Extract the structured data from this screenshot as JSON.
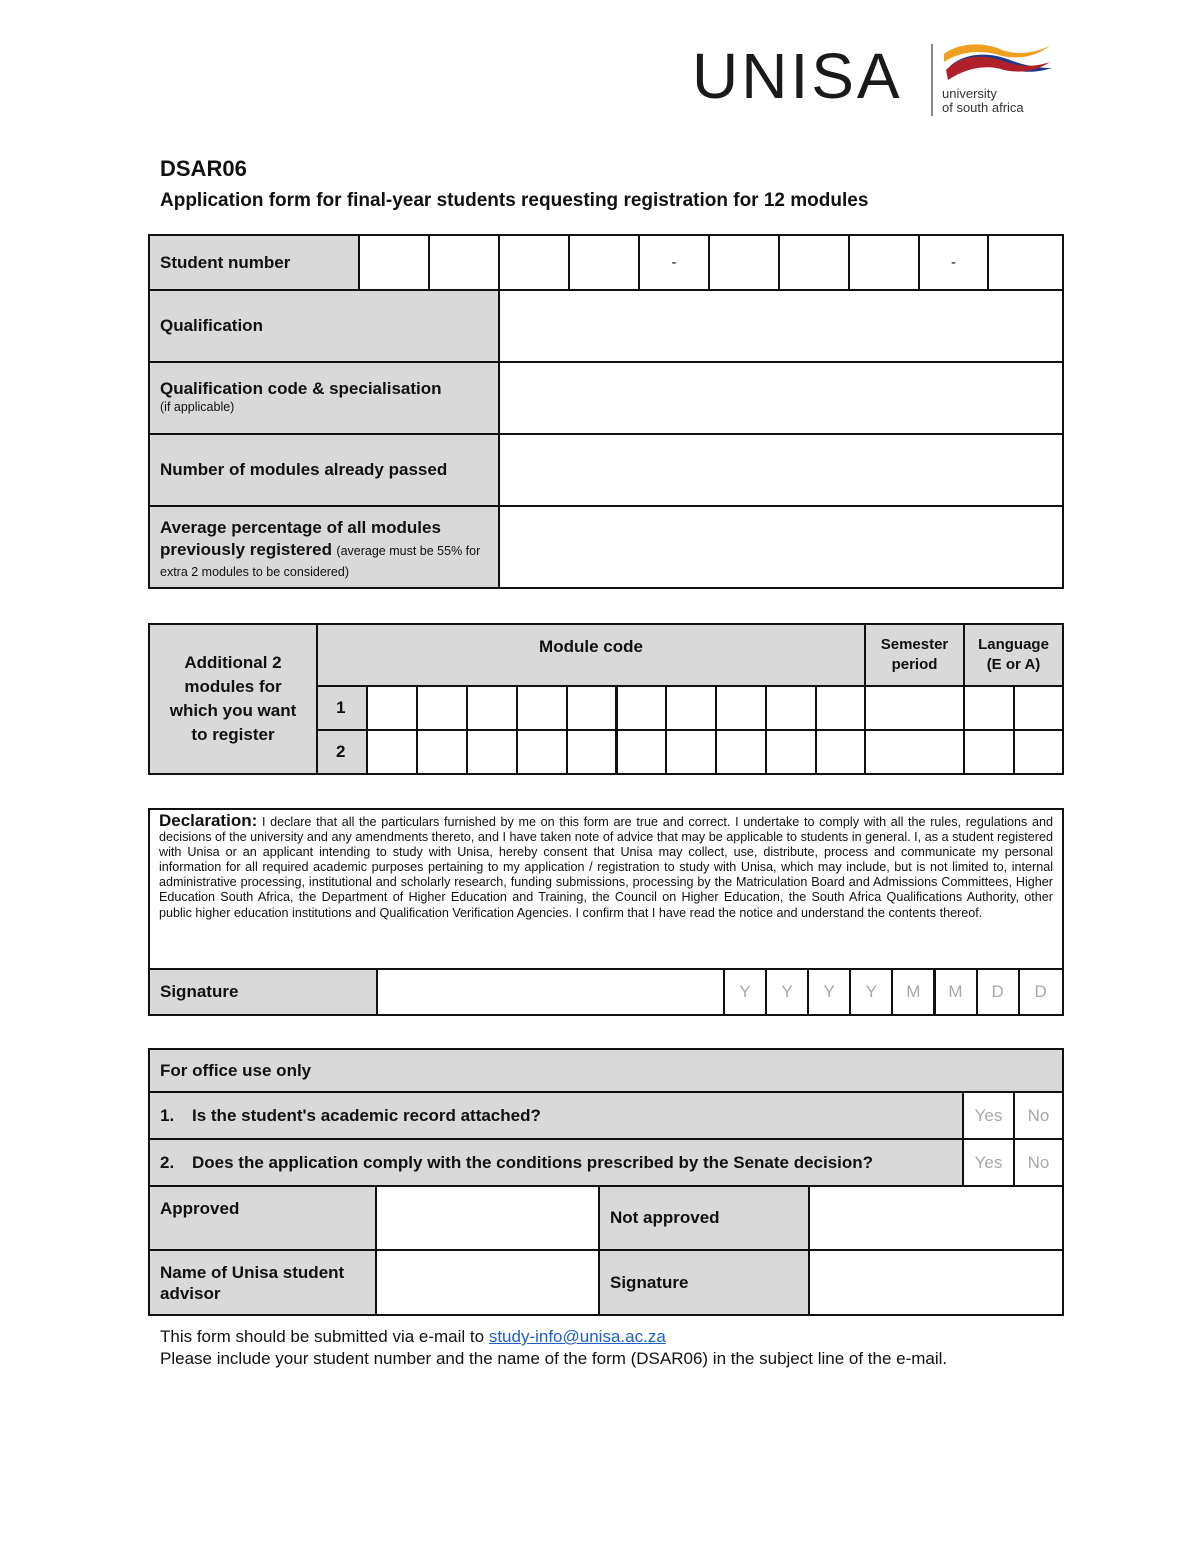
{
  "header": {
    "logo_text": "UNISA",
    "logo_tagline_1": "university",
    "logo_tagline_2": "of south africa",
    "brand_colors": {
      "orange": "#f0a020",
      "red": "#b0202a",
      "blue": "#1f3a8a"
    },
    "form_code": "DSAR06",
    "form_title": "Application form for final-year students requesting registration for 12 modules"
  },
  "student_info": {
    "student_number_label": "Student number",
    "student_number_separators": [
      "-",
      "-"
    ],
    "qualification_label": "Qualification",
    "qualification_code_label": "Qualification code & specialisation",
    "qualification_code_note": "(if applicable)",
    "modules_passed_label": "Number of modules already passed",
    "average_label": "Average percentage of all modules previously registered",
    "average_note": "(average must be 55% for extra 2 modules to be considered)",
    "qualification_value": "",
    "qualification_code_value": "",
    "modules_passed_value": "",
    "average_value": ""
  },
  "modules": {
    "side_label": "Additional 2 modules for which you want to register",
    "module_code_header": "Module code",
    "semester_header": "Semester period",
    "language_header": "Language (E or A)",
    "rows": [
      {
        "num": "1"
      },
      {
        "num": "2"
      }
    ]
  },
  "declaration": {
    "title": "Declaration:",
    "text": "I declare that all the particulars furnished by me on this form are true and correct. I undertake to comply with all the rules, regulations and decisions of the university and any amendments thereto, and I have taken note of advice that may be applicable to students in general. I, as a student registered with Unisa or an applicant intending to study with Unisa, hereby consent that Unisa may collect, use, distribute, process and communicate my personal information for all required academic purposes pertaining to my application / registration to study with Unisa, which may include, but is not limited to, internal administrative processing, institutional and scholarly research, funding submissions, processing by the Matriculation Board and Admissions Committees, Higher Education South Africa, the Department of Higher Education and Training, the Council on Higher Education, the South Africa Qualifications Authority, other public higher education institutions and Qualification Verification Agencies. I confirm that I have read the notice and understand the contents thereof.",
    "signature_label": "Signature",
    "date_placeholders": [
      "Y",
      "Y",
      "Y",
      "Y",
      "M",
      "M",
      "D",
      "D"
    ]
  },
  "office": {
    "title": "For office use only",
    "questions": [
      {
        "num": "1.",
        "text": "Is the student's academic record attached?",
        "yes": "Yes",
        "no": "No"
      },
      {
        "num": "2.",
        "text": "Does the application comply with the conditions prescribed by the Senate decision?",
        "yes": "Yes",
        "no": "No"
      }
    ],
    "approved_label": "Approved",
    "not_approved_label": "Not approved",
    "advisor_label": "Name of Unisa student advisor",
    "signature_label": "Signature"
  },
  "footer": {
    "line1_prefix": "This form should be submitted via e-mail to ",
    "email": "study-info@unisa.ac.za",
    "line2": "Please include your student number and the name of the form (DSAR06) in the subject line of the e-mail."
  }
}
